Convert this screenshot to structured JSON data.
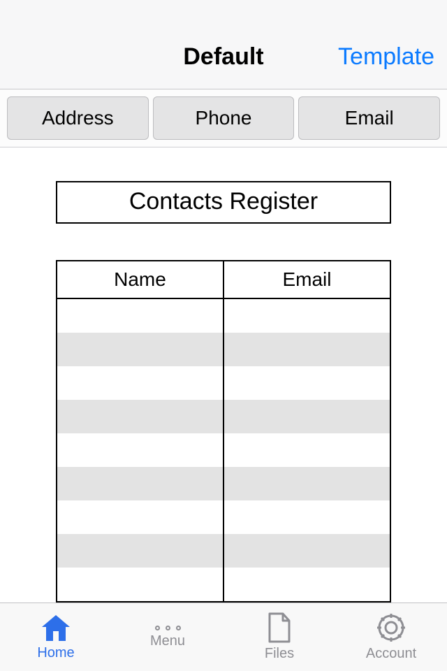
{
  "navbar": {
    "title": "Default",
    "right": "Template"
  },
  "tabs": [
    "Address",
    "Phone",
    "Email"
  ],
  "sheet": {
    "title": "Contacts Register",
    "columns": [
      "Name",
      "Email"
    ]
  },
  "tabbar": [
    {
      "label": "Home",
      "active": true
    },
    {
      "label": "Menu",
      "active": false
    },
    {
      "label": "Files",
      "active": false
    },
    {
      "label": "Account",
      "active": false
    }
  ],
  "colors": {
    "accent": "#2d6fe9",
    "link": "#0a7aff",
    "muted": "#8e8e93"
  }
}
